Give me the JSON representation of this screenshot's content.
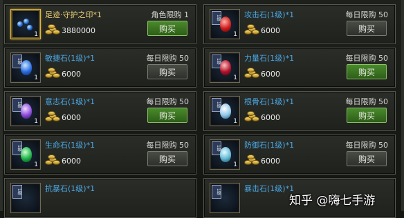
{
  "items": [
    {
      "name": "足迹·守护之印*1",
      "limit": "角色限购 1",
      "price": "3880000",
      "buy": "购买",
      "slot_badge": "",
      "slot_count": "1",
      "gem": "blue-orbs",
      "highlight": true,
      "button": "green"
    },
    {
      "name": "攻击石(1级)*1",
      "limit": "每日限购 50",
      "price": "6000",
      "buy": "购买",
      "slot_badge": "1级",
      "slot_count": "1",
      "gem": "red",
      "highlight": false,
      "button": "grey"
    },
    {
      "name": "敏捷石(1级)*1",
      "limit": "每日限购 50",
      "price": "6000",
      "buy": "购买",
      "slot_badge": "1级",
      "slot_count": "1",
      "gem": "blue",
      "highlight": false,
      "button": "grey"
    },
    {
      "name": "力量石(1级)*1",
      "limit": "每日限购 50",
      "price": "6000",
      "buy": "购买",
      "slot_badge": "1级",
      "slot_count": "1",
      "gem": "crimson",
      "highlight": false,
      "button": "green"
    },
    {
      "name": "意志石(1级)*1",
      "limit": "每日限购 50",
      "price": "6000",
      "buy": "购买",
      "slot_badge": "1级",
      "slot_count": "1",
      "gem": "purple",
      "highlight": false,
      "button": "green"
    },
    {
      "name": "根骨石(1级)*1",
      "limit": "每日限购 50",
      "price": "6000",
      "buy": "购买",
      "slot_badge": "1级",
      "slot_count": "1",
      "gem": "pale-blue",
      "highlight": false,
      "button": "green"
    },
    {
      "name": "生命石(1级)*1",
      "limit": "每日限购 50",
      "price": "6000",
      "buy": "购买",
      "slot_badge": "1级",
      "slot_count": "1",
      "gem": "green",
      "highlight": false,
      "button": "grey"
    },
    {
      "name": "防御石(1级)*1",
      "limit": "每日限购 50",
      "price": "6000",
      "buy": "购买",
      "slot_badge": "1级",
      "slot_count": "1",
      "gem": "teal",
      "highlight": false,
      "button": "grey"
    },
    {
      "name": "抗暴石(1级)*1",
      "limit": "",
      "price": "",
      "buy": "",
      "slot_badge": "1级",
      "slot_count": "",
      "gem": "",
      "highlight": false,
      "button": ""
    },
    {
      "name": "暴击石(1级)*1",
      "limit": "",
      "price": "",
      "buy": "",
      "slot_badge": "1级",
      "slot_count": "",
      "gem": "",
      "highlight": false,
      "button": ""
    }
  ],
  "watermark": "知乎 @嗨七手游",
  "colors": {
    "name_blue": "#4aa9e6",
    "name_gold": "#f0d477",
    "buy_green": "#3d7a22",
    "card_bg": "#262824",
    "card_border": "#55574f"
  }
}
